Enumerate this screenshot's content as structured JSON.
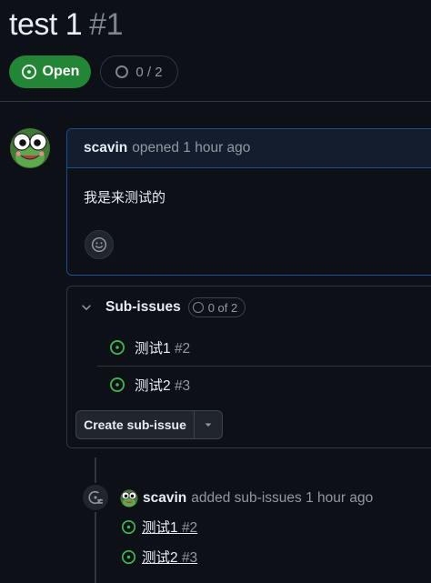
{
  "issue": {
    "title": "test 1",
    "number": "#1"
  },
  "state": {
    "label": "Open",
    "icon": "issue-open-icon",
    "color": "#238636"
  },
  "progress": {
    "text": "0 / 2",
    "completed": 0,
    "total": 2
  },
  "comment": {
    "author": "scavin",
    "meta": "opened 1 hour ago",
    "body": "我是来测试的",
    "reaction_icon": "smiley-icon"
  },
  "sub_issues": {
    "title": "Sub-issues",
    "count_text": "0 of 2",
    "items": [
      {
        "title": "测试1",
        "number": "#2",
        "icon": "issue-open-icon"
      },
      {
        "title": "测试2",
        "number": "#3",
        "icon": "issue-open-icon"
      }
    ],
    "create_label": "Create sub-issue"
  },
  "event": {
    "author": "scavin",
    "text": "added sub-issues 1 hour ago",
    "icon": "sub-issue-icon",
    "items": [
      {
        "title": "测试1",
        "number": "#2"
      },
      {
        "title": "测试2",
        "number": "#3"
      }
    ]
  },
  "colors": {
    "background": "#0d1117",
    "border": "#30363d",
    "accent_blue": "#1f4f8f",
    "open_green": "#3fb950"
  }
}
